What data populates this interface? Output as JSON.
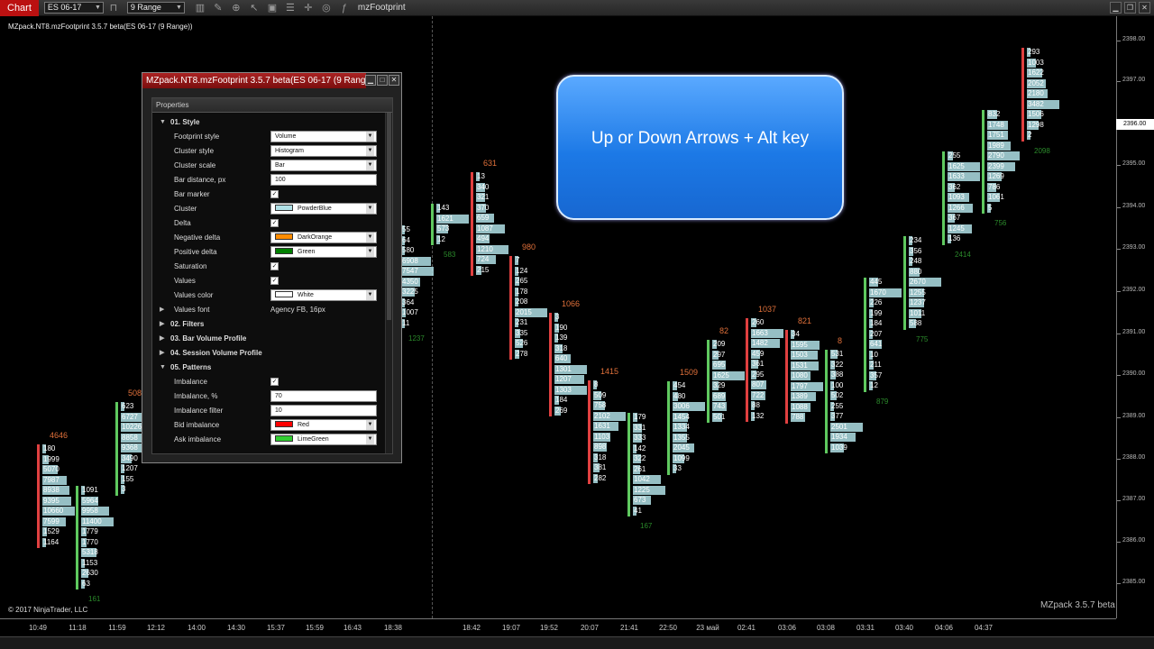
{
  "toolbar": {
    "chart_tab": "Chart",
    "instrument": "ES 06-17",
    "period": "9 Range",
    "indicator_title": "mzFootprint",
    "icons": [
      "magnet-icon",
      "bars-icon",
      "pencil-icon",
      "zoom-icon",
      "pointer-icon",
      "data-box-icon",
      "properties-icon",
      "crosshair-icon",
      "strategy-icon",
      "indicator-icon"
    ]
  },
  "chart": {
    "label": "MZpack.NT8.mzFootprint 3.5.7 beta(ES 06-17 (9 Range))",
    "copyright": "© 2017 NinjaTrader, LLC",
    "watermark": "MZpack 3.5.7 beta",
    "current_price": "2396.00",
    "price_ticks": [
      "2398.00",
      "2397.00",
      "2395.00",
      "2394.00",
      "2393.00",
      "2392.00",
      "2391.00",
      "2390.00",
      "2389.00",
      "2388.00",
      "2387.00",
      "2386.00",
      "2385.00"
    ],
    "time_ticks": [
      "10:49",
      "11:18",
      "11:59",
      "12:12",
      "14:00",
      "14:30",
      "15:37",
      "15:59",
      "16:43",
      "18:38",
      "18:42",
      "19:07",
      "19:52",
      "20:07",
      "21:41",
      "22:50",
      "23 май",
      "02:41",
      "03:06",
      "03:08",
      "03:31",
      "03:40",
      "04:06",
      "04:37"
    ],
    "colors": {
      "bar": "#b0e0e6",
      "positive": "#5fc95f",
      "negative": "#e04040",
      "delta_neg": "#e0703a",
      "delta_pos": "#2b8a2b"
    },
    "clusters": [
      {
        "top_label": "4646",
        "top_color": "#e0703a",
        "values": [
          180,
          1999,
          5070,
          7987,
          8938,
          9395,
          10660,
          7599,
          1529,
          1164
        ],
        "bottom_label": "",
        "marker": "#e04040"
      },
      {
        "top_label": "",
        "top_color": "#e0703a",
        "values": [
          1091,
          5964,
          9958,
          11400,
          1779,
          1770,
          5318,
          1153,
          2630,
          63
        ],
        "bottom_label": "161",
        "marker": "#5fc95f"
      },
      {
        "top_label": "508",
        "top_color": "#e0703a",
        "values": [
          623,
          6727,
          10226,
          8858,
          9368,
          3490,
          1207,
          155,
          3
        ],
        "bottom_label": "",
        "marker": "#5fc95f"
      },
      {
        "top_label": "",
        "top_color": "#e0703a",
        "values": [
          55,
          64,
          580,
          6908,
          7547,
          4350,
          3225,
          364,
          1007,
          11
        ],
        "bottom_label": "1237",
        "marker": "#5fc95f"
      },
      {
        "top_label": "",
        "top_color": "#e0703a",
        "values": [
          143,
          1621,
          573,
          12
        ],
        "bottom_label": "583",
        "marker": "#5fc95f"
      },
      {
        "top_label": "631",
        "top_color": "#e0703a",
        "values": [
          13,
          340,
          321,
          370,
          659,
          1087,
          494,
          1210,
          724,
          215
        ],
        "bottom_label": "",
        "marker": "#e04040"
      },
      {
        "top_label": "980",
        "top_color": "#e0703a",
        "values": [
          7,
          124,
          265,
          178,
          208,
          2015,
          231,
          335,
          526,
          278
        ],
        "bottom_label": "",
        "marker": "#e04040"
      },
      {
        "top_label": "1066",
        "top_color": "#e0703a",
        "values": [
          3,
          190,
          139,
          318,
          640,
          1301,
          1207,
          1303,
          184,
          269
        ],
        "bottom_label": "",
        "marker": "#e04040"
      },
      {
        "top_label": "1415",
        "top_color": "#e0703a",
        "values": [
          8,
          509,
          758,
          2102,
          1631,
          1103,
          898,
          318,
          381,
          282
        ],
        "bottom_label": "",
        "marker": "#e04040"
      },
      {
        "top_label": "",
        "top_color": "#e0703a",
        "values": [
          179,
          331,
          333,
          142,
          322,
          261,
          1042,
          1225,
          673,
          41
        ],
        "bottom_label": "167",
        "marker": "#5fc95f"
      },
      {
        "top_label": "1509",
        "top_color": "#e0703a",
        "values": [
          454,
          480,
          3006,
          1454,
          1334,
          1355,
          2045,
          1099,
          33
        ],
        "bottom_label": "",
        "marker": "#5fc95f"
      },
      {
        "top_label": "82",
        "top_color": "#e0703a",
        "values": [
          209,
          297,
          695,
          1625,
          329,
          689,
          743,
          501
        ],
        "bottom_label": "",
        "marker": "#5fc95f"
      },
      {
        "top_label": "1037",
        "top_color": "#e0703a",
        "values": [
          260,
          1663,
          1482,
          459,
          361,
          295,
          807,
          722,
          88,
          132
        ],
        "bottom_label": "",
        "marker": "#e04040"
      },
      {
        "top_label": "821",
        "top_color": "#e0703a",
        "values": [
          34,
          1595,
          1503,
          1531,
          1080,
          1797,
          1389,
          1088,
          788
        ],
        "bottom_label": "",
        "marker": "#e04040"
      },
      {
        "top_label": "8",
        "top_color": "#e0703a",
        "values": [
          531,
          322,
          388,
          100,
          502,
          255,
          377,
          2501,
          1934,
          1039
        ],
        "bottom_label": "",
        "marker": "#5fc95f"
      },
      {
        "top_label": "",
        "top_color": "#e0703a",
        "values": [
          445,
          1670,
          226,
          199,
          184,
          207,
          641,
          10,
          211,
          357,
          12
        ],
        "bottom_label": "879",
        "marker": "#5fc95f"
      },
      {
        "top_label": "",
        "top_color": "#e0703a",
        "values": [
          234,
          356,
          248,
          880,
          2670,
          1255,
          1237,
          1011,
          588
        ],
        "bottom_label": "775",
        "marker": "#5fc95f"
      },
      {
        "top_label": "",
        "top_color": "#e0703a",
        "values": [
          255,
          1625,
          1633,
          362,
          1093,
          1266,
          367,
          1245,
          136
        ],
        "bottom_label": "2414",
        "marker": "#5fc95f"
      },
      {
        "top_label": "",
        "top_color": "#e0703a",
        "values": [
          832,
          1748,
          1751,
          1989,
          2790,
          2399,
          1269,
          786,
          1061,
          5
        ],
        "bottom_label": "756",
        "marker": "#5fc95f"
      },
      {
        "top_label": "",
        "top_color": "#e0703a",
        "values": [
          293,
          1003,
          1622,
          2052,
          2180,
          3482,
          1506,
          1298,
          2
        ],
        "bottom_label": "2098",
        "marker": "#e04040"
      }
    ]
  },
  "callout": {
    "text": "Up or Down Arrows + Alt key"
  },
  "properties": {
    "title": "MZpack.NT8.mzFootprint 3.5.7 beta(ES 06-17 (9 Range)",
    "header": "Properties",
    "rows": [
      {
        "kind": "section",
        "caret": "▼",
        "label": "01. Style"
      },
      {
        "kind": "select",
        "label": "Footprint style",
        "value": "Volume"
      },
      {
        "kind": "select",
        "label": "Cluster style",
        "value": "Histogram"
      },
      {
        "kind": "select",
        "label": "Cluster scale",
        "value": "Bar"
      },
      {
        "kind": "input",
        "label": "Bar distance, px",
        "value": "100"
      },
      {
        "kind": "check",
        "label": "Bar marker",
        "value": "✓"
      },
      {
        "kind": "color",
        "label": "Cluster",
        "value": "PowderBlue",
        "swatch": "#b0e0e6"
      },
      {
        "kind": "check",
        "label": "Delta",
        "value": "✓"
      },
      {
        "kind": "color",
        "label": "Negative delta",
        "value": "DarkOrange",
        "swatch": "#ff8c00"
      },
      {
        "kind": "color",
        "label": "Positive delta",
        "value": "Green",
        "swatch": "#008000"
      },
      {
        "kind": "check",
        "label": "Saturation",
        "value": "✓"
      },
      {
        "kind": "check",
        "label": "Values",
        "value": "✓"
      },
      {
        "kind": "color",
        "label": "Values color",
        "value": "White",
        "swatch": "#ffffff"
      },
      {
        "kind": "text",
        "caret": "▶",
        "label": "Values font",
        "value": "Agency FB, 16px"
      },
      {
        "kind": "section",
        "caret": "▶",
        "label": "02. Filters"
      },
      {
        "kind": "section",
        "caret": "▶",
        "label": "03. Bar Volume Profile"
      },
      {
        "kind": "section",
        "caret": "▶",
        "label": "04. Session Volume Profile"
      },
      {
        "kind": "section",
        "caret": "▼",
        "label": "05. Patterns"
      },
      {
        "kind": "check",
        "label": "Imbalance",
        "value": "✓"
      },
      {
        "kind": "input",
        "label": "Imbalance, %",
        "value": "70"
      },
      {
        "kind": "input",
        "label": "Imbalance filter",
        "value": "10"
      },
      {
        "kind": "color",
        "label": "Bid imbalance",
        "value": "Red",
        "swatch": "#ff0000"
      },
      {
        "kind": "color",
        "label": "Ask imbalance",
        "value": "LimeGreen",
        "swatch": "#32cd32"
      }
    ]
  }
}
